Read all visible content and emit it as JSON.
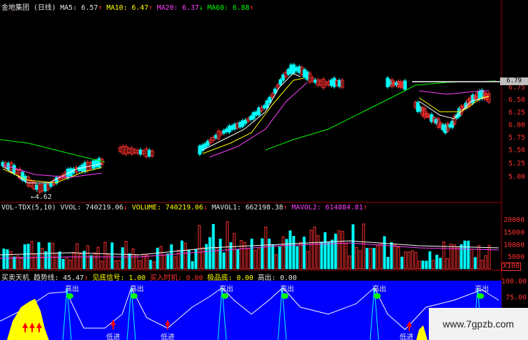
{
  "header": {
    "stock_title": "金地集团 (日线)",
    "ma5_label": "MA5:",
    "ma5_value": "6.57",
    "ma10_label": "MA10:",
    "ma10_value": "6.47",
    "ma20_label": "MA20:",
    "ma20_value": "6.37",
    "ma60_label": "MA60:",
    "ma60_value": "6.88",
    "up_arrow": "↑",
    "down_arrow": "↓"
  },
  "price_axis": {
    "ticks": [
      "6.75",
      "6.50",
      "6.25",
      "6.00",
      "5.75",
      "5.50",
      "5.25",
      "5.00"
    ],
    "last_price_tag": "6.79",
    "low_annotation": "←4.62"
  },
  "volume_header": {
    "indicator": "VOL-TDX(5,10)",
    "vvol_label": "VVOL:",
    "vvol_value": "740219.06",
    "volume_label": "VOLUME:",
    "volume_value": "740219.06",
    "mavol1_label": "MAVOL1:",
    "mavol1_value": "662198.38",
    "mavol2_label": "MAVOL2:",
    "mavol2_value": "614884.81"
  },
  "volume_axis": {
    "ticks": [
      "20000",
      "15000",
      "10000",
      "5000"
    ],
    "unit": "X100"
  },
  "signal_header": {
    "name": "买卖天机",
    "trend_label": "趋势线:",
    "trend_value": "45.47",
    "bottom_label": "见底信号:",
    "bottom_value": "1.00",
    "buy_label": "买入时机:",
    "buy_value": "0.00",
    "extreme_label": "极品底:",
    "extreme_value": "0.00",
    "top_label": "高出:",
    "top_value": "0.00"
  },
  "signal_axis": {
    "ticks": [
      "100.00",
      "75.00"
    ]
  },
  "signal_markers": {
    "high_out": "高出",
    "low_absorb": "低进"
  },
  "watermark": "www.7gpzb.com",
  "colors": {
    "up": "#ff3030",
    "down": "#00ffff",
    "ma5": "#ffffff",
    "ma10": "#ffff00",
    "ma20": "#ff40ff",
    "ma60": "#00ff00",
    "signal_bg": "#0000ff"
  }
}
